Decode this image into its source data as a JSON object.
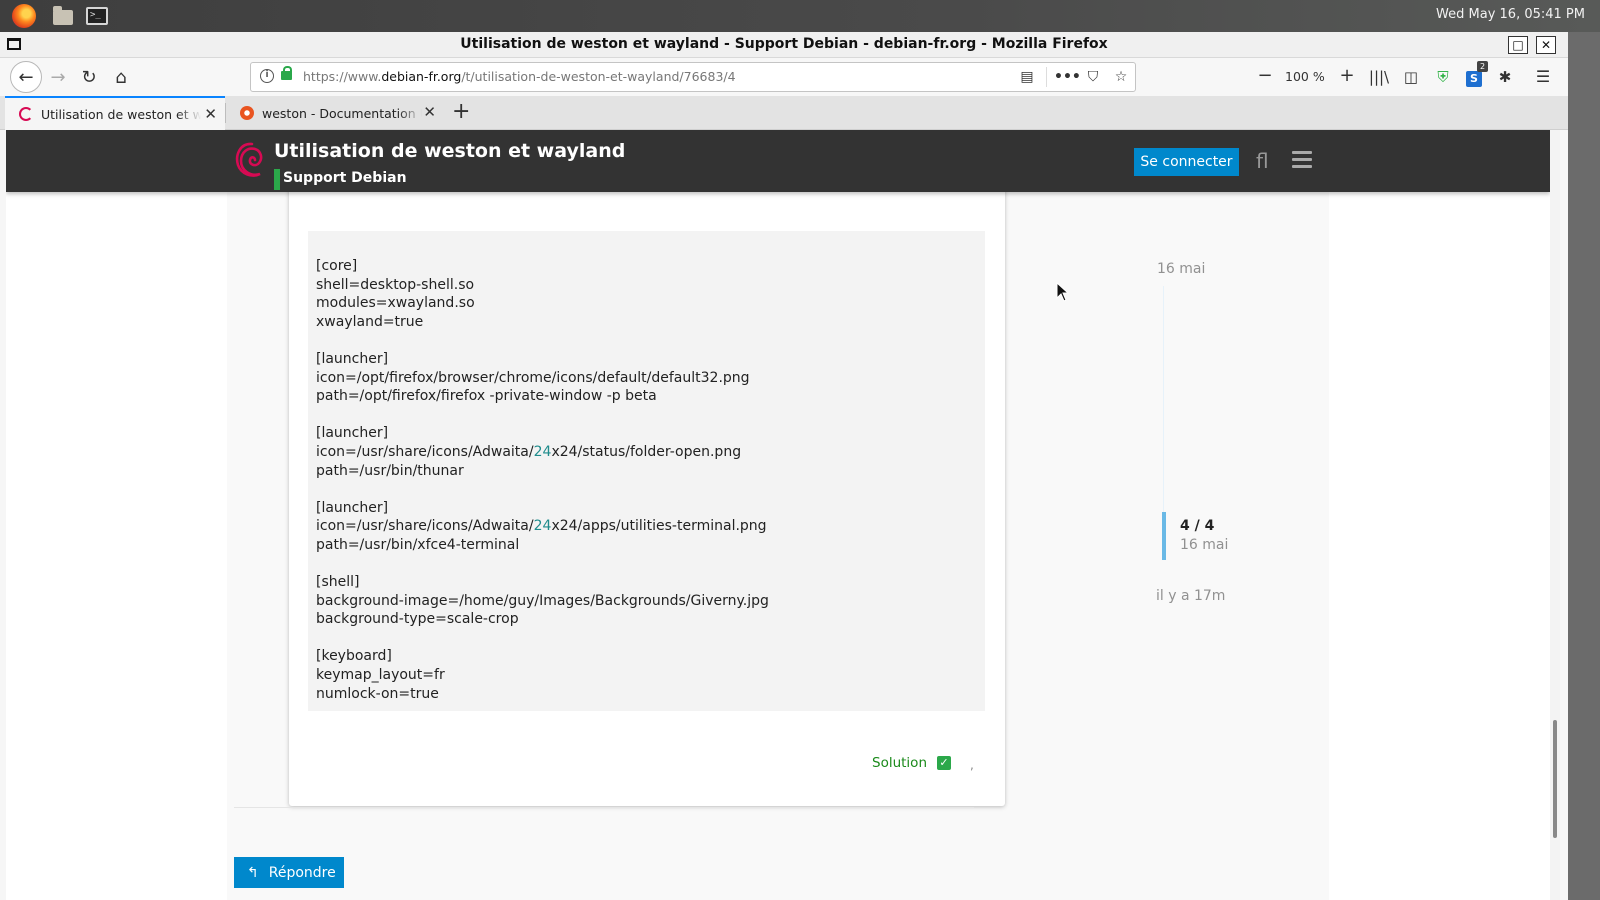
{
  "desktop": {
    "clock": "Wed May 16, 05:41 PM",
    "launchers": [
      "firefox-icon",
      "files-icon",
      "terminal-icon"
    ]
  },
  "window": {
    "title": "Utilisation de weston et wayland - Support Debian - debian-fr.org - Mozilla Firefox",
    "max_glyph": "□",
    "close_glyph": "✕"
  },
  "navbar": {
    "back_glyph": "←",
    "forward_glyph": "→",
    "reload_glyph": "↻",
    "home_glyph": "⌂",
    "url_prefix": "https://www.",
    "url_domain": "debian-fr.org",
    "url_path": "/t/utilisation-de-weston-et-wayland/76683/4",
    "more_glyph": "•••",
    "zoom_out": "−",
    "zoom_level": "100 %",
    "zoom_in": "+",
    "ext_letter": "S",
    "ext_badge": "2"
  },
  "tabs": [
    {
      "label": "Utilisation de weston et wayland",
      "active": true
    },
    {
      "label": "weston - Documentation Ubuntu",
      "active": false
    }
  ],
  "tab_close_glyph": "✕",
  "new_tab_glyph": "+",
  "site": {
    "topic_title": "Utilisation de weston et wayland",
    "category": "Support Debian",
    "category_color": "#2ba84a",
    "login_label": "Se connecter",
    "search_glyph": "ﬂ",
    "accent": "#0088cc"
  },
  "post": {
    "code_lines": [
      {
        "pre": "[core]"
      },
      {
        "pre": "shell=desktop-shell.so"
      },
      {
        "pre": "modules=xwayland.so"
      },
      {
        "pre": "xwayland=true"
      },
      {
        "pre": ""
      },
      {
        "pre": "[launcher]"
      },
      {
        "pre": "icon=/opt/firefox/browser/chrome/icons/default/default32.png"
      },
      {
        "pre": "path=/opt/firefox/firefox -private-window -p beta"
      },
      {
        "pre": ""
      },
      {
        "pre": "[launcher]"
      },
      {
        "pre": "icon=/usr/share/icons/Adwaita/",
        "hl": "24",
        "post": "x24/status/folder-open.png"
      },
      {
        "pre": "path=/usr/bin/thunar"
      },
      {
        "pre": ""
      },
      {
        "pre": "[launcher]"
      },
      {
        "pre": "icon=/usr/share/icons/Adwaita/",
        "hl": "24",
        "post": "x24/apps/utilities-terminal.png"
      },
      {
        "pre": "path=/usr/bin/xfce4-terminal"
      },
      {
        "pre": ""
      },
      {
        "pre": "[shell]"
      },
      {
        "pre": "background-image=/home/guy/Images/Backgrounds/Giverny.jpg"
      },
      {
        "pre": "background-type=scale-crop"
      },
      {
        "pre": ""
      },
      {
        "pre": "[keyboard]"
      },
      {
        "pre": "keymap_layout=fr"
      },
      {
        "pre": "numlock-on=true"
      }
    ],
    "solution_label": "Solution",
    "solution_check": "✓",
    "trailing_mark": ","
  },
  "timeline": {
    "start_date": "16 mai",
    "position": "4 / 4",
    "position_date": "16 mai",
    "last_activity": "il y a 17m",
    "progress": 1.0
  },
  "reply": {
    "label": "Répondre",
    "icon_glyph": "↰"
  }
}
